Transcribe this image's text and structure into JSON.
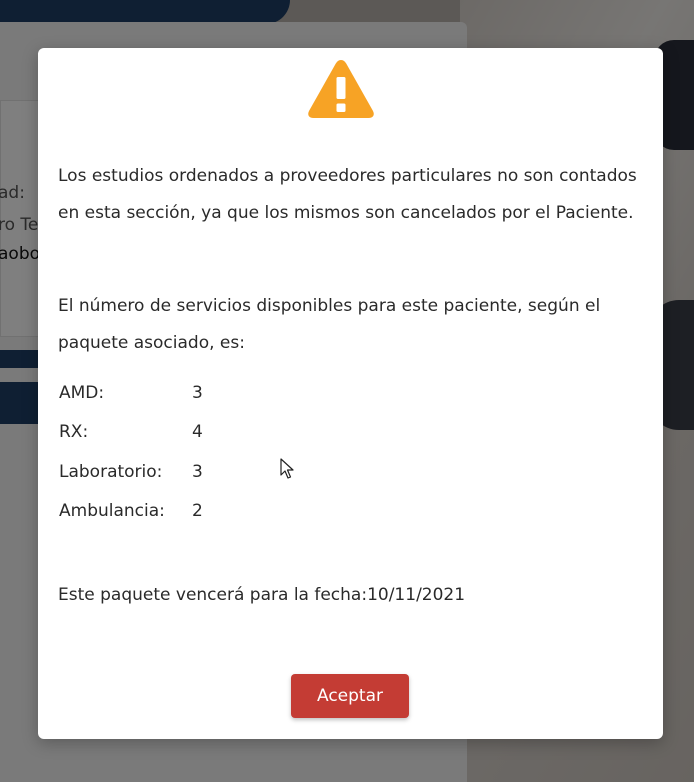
{
  "background": {
    "fragments": [
      "ad:",
      "ro Te",
      "aobo"
    ]
  },
  "modal": {
    "icon": "warning-triangle-icon",
    "icon_color": "#f7a325",
    "paragraph1": "Los estudios ordenados a proveedores particulares no son contados en esta sección, ya que los mismos son cancelados por el Paciente.",
    "paragraph2": "El número de servicios disponibles para este paciente, según el paquete asociado, es:",
    "services": [
      {
        "label": "AMD:",
        "value": "3"
      },
      {
        "label": "RX:",
        "value": "4"
      },
      {
        "label": "Laboratorio:",
        "value": "3"
      },
      {
        "label": "Ambulancia:",
        "value": "2"
      }
    ],
    "expiry_text": "Este paquete vencerá para la fecha:10/11/2021",
    "accept_label": "Aceptar",
    "accept_color": "#c43c34"
  }
}
